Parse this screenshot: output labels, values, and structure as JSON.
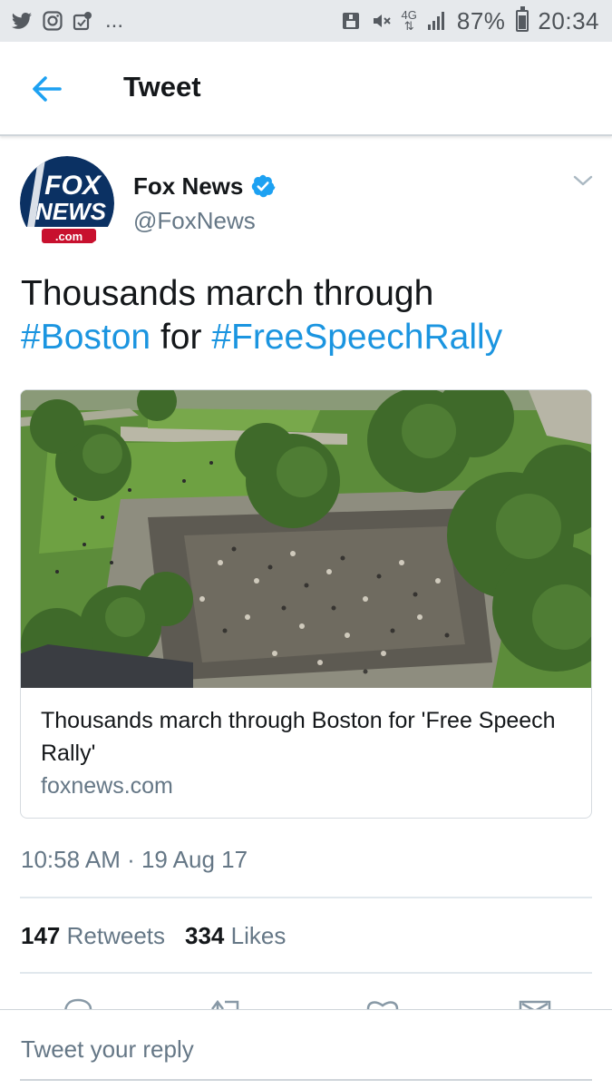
{
  "status_bar": {
    "battery": "87%",
    "time": "20:34",
    "network": "4G",
    "dots": "...",
    "left_icons": [
      "twitter-icon",
      "instagram-icon",
      "notification-icon"
    ],
    "right_icons": [
      "save-icon",
      "mute-icon",
      "network-4g-icon",
      "signal-icon",
      "battery-icon"
    ]
  },
  "header": {
    "title": "Tweet",
    "back_icon": "back-arrow-icon"
  },
  "tweet": {
    "author": {
      "name": "Fox News",
      "handle": "@FoxNews",
      "verified": true,
      "avatar_logo_text": [
        "FOX",
        "NEWS",
        ".com"
      ]
    },
    "text": {
      "plain_1": "Thousands march through",
      "hashtag_1": "#Boston",
      "plain_2": "for",
      "hashtag_2": "#FreeSpeechRally"
    },
    "card": {
      "title": "Thousands march through Boston for 'Free Speech Rally'",
      "domain": "foxnews.com"
    },
    "timestamp": "10:58 AM · 19 Aug 17",
    "stats": {
      "retweets_count": "147",
      "retweets_label": "Retweets",
      "likes_count": "334",
      "likes_label": "Likes"
    },
    "action_icons": [
      "reply-icon",
      "retweet-icon",
      "like-icon",
      "share-icon"
    ]
  },
  "reply": {
    "placeholder": "Tweet your reply"
  },
  "colors": {
    "link_blue": "#1b95e0",
    "verified_blue": "#1da1f2",
    "secondary_text": "#657786",
    "status_bar_bg": "#e6e9ec"
  }
}
